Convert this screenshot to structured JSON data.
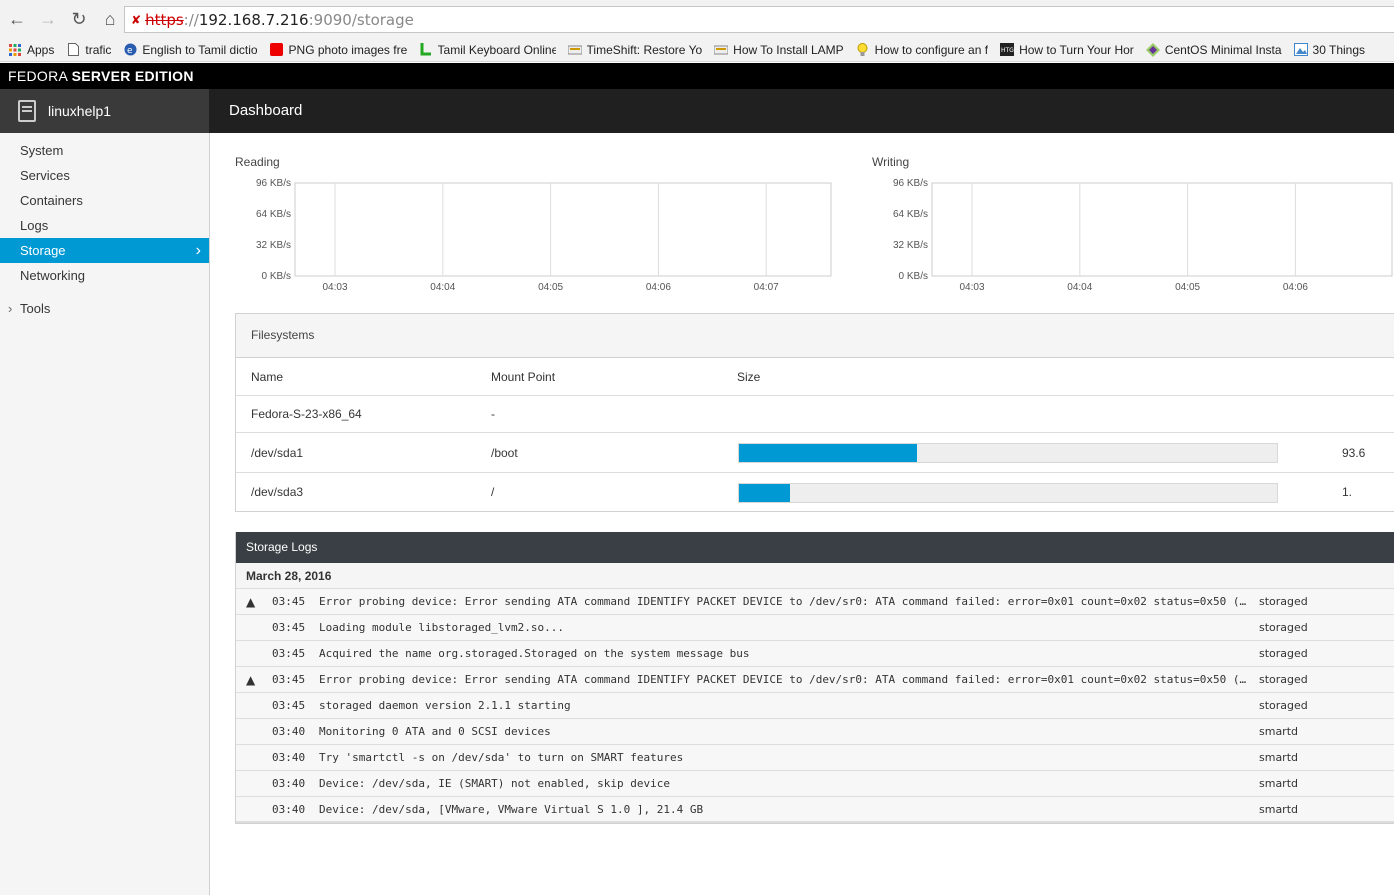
{
  "browser": {
    "url_scheme": "https",
    "url_sep": "://",
    "url_host": "192.168.7.216",
    "url_rest": ":9090/storage",
    "bookmarks": [
      {
        "label": "Apps",
        "icon": "apps-grid-icon"
      },
      {
        "label": "trafic",
        "icon": "page-icon"
      },
      {
        "label": "English to Tamil dictio",
        "icon": "globe-icon"
      },
      {
        "label": "PNG photo images fre",
        "icon": "red-square-icon"
      },
      {
        "label": "Tamil Keyboard Online",
        "icon": "green-l-icon"
      },
      {
        "label": "TimeShift: Restore Yo",
        "icon": "bookmark-icon"
      },
      {
        "label": "How To Install LAMP",
        "icon": "bookmark-icon"
      },
      {
        "label": "How to configure an f",
        "icon": "bulb-icon"
      },
      {
        "label": "How to Turn Your Hor",
        "icon": "htg-icon"
      },
      {
        "label": "CentOS Minimal Insta",
        "icon": "centos-icon"
      },
      {
        "label": "30 Things",
        "icon": "picture-icon"
      }
    ]
  },
  "app": {
    "brand_light": "FEDORA ",
    "brand_bold": "SERVER EDITION",
    "host": "linuxhelp1",
    "breadcrumb": "Dashboard"
  },
  "sidebar": {
    "items": [
      "System",
      "Services",
      "Containers",
      "Logs",
      "Storage",
      "Networking"
    ],
    "active": "Storage",
    "tools": "Tools"
  },
  "charts": {
    "reading_title": "Reading",
    "writing_title": "Writing"
  },
  "chart_data": [
    {
      "type": "line",
      "title": "Reading",
      "y_ticks": [
        "96 KB/s",
        "64 KB/s",
        "32 KB/s",
        "0 KB/s"
      ],
      "x_ticks": [
        "04:03",
        "04:04",
        "04:05",
        "04:06",
        "04:07"
      ],
      "ylim": [
        0,
        96
      ],
      "series": []
    },
    {
      "type": "line",
      "title": "Writing",
      "y_ticks": [
        "96 KB/s",
        "64 KB/s",
        "32 KB/s",
        "0 KB/s"
      ],
      "x_ticks": [
        "04:03",
        "04:04",
        "04:05",
        "04:06"
      ],
      "ylim": [
        0,
        96
      ],
      "series": []
    }
  ],
  "filesystems": {
    "title": "Filesystems",
    "columns": {
      "name": "Name",
      "mount": "Mount Point",
      "size": "Size"
    },
    "rows": [
      {
        "name": "Fedora-S-23-x86_64",
        "mount": "-",
        "usage": null,
        "size": ""
      },
      {
        "name": "/dev/sda1",
        "mount": "/boot",
        "usage": 0.33,
        "size": "93.6"
      },
      {
        "name": "/dev/sda3",
        "mount": "/",
        "usage": 0.095,
        "size": "1."
      }
    ]
  },
  "logs": {
    "title": "Storage Logs",
    "date": "March 28, 2016",
    "entries": [
      {
        "warn": true,
        "time": "03:45",
        "msg": "Error probing device: Error sending ATA command IDENTIFY PACKET DEVICE to /dev/sr0: ATA command failed: error=0x01 count=0x02 status=0x50 (…",
        "src": "storaged"
      },
      {
        "warn": false,
        "time": "03:45",
        "msg": "Loading module libstoraged_lvm2.so...",
        "src": "storaged"
      },
      {
        "warn": false,
        "time": "03:45",
        "msg": "Acquired the name org.storaged.Storaged on the system message bus",
        "src": "storaged"
      },
      {
        "warn": true,
        "time": "03:45",
        "msg": "Error probing device: Error sending ATA command IDENTIFY PACKET DEVICE to /dev/sr0: ATA command failed: error=0x01 count=0x02 status=0x50 (…",
        "src": "storaged"
      },
      {
        "warn": false,
        "time": "03:45",
        "msg": "storaged daemon version 2.1.1 starting",
        "src": "storaged"
      },
      {
        "warn": false,
        "time": "03:40",
        "msg": "Monitoring 0 ATA and 0 SCSI devices",
        "src": "smartd"
      },
      {
        "warn": false,
        "time": "03:40",
        "msg": "Try 'smartctl -s on /dev/sda' to turn on SMART features",
        "src": "smartd"
      },
      {
        "warn": false,
        "time": "03:40",
        "msg": "Device: /dev/sda, IE (SMART) not enabled, skip device",
        "src": "smartd"
      },
      {
        "warn": false,
        "time": "03:40",
        "msg": "Device: /dev/sda, [VMware, VMware Virtual S 1.0 ], 21.4 GB",
        "src": "smartd"
      }
    ]
  },
  "colors": {
    "accent": "#0099d3",
    "brand_bar": "#000000",
    "host_bar": "#202020"
  }
}
